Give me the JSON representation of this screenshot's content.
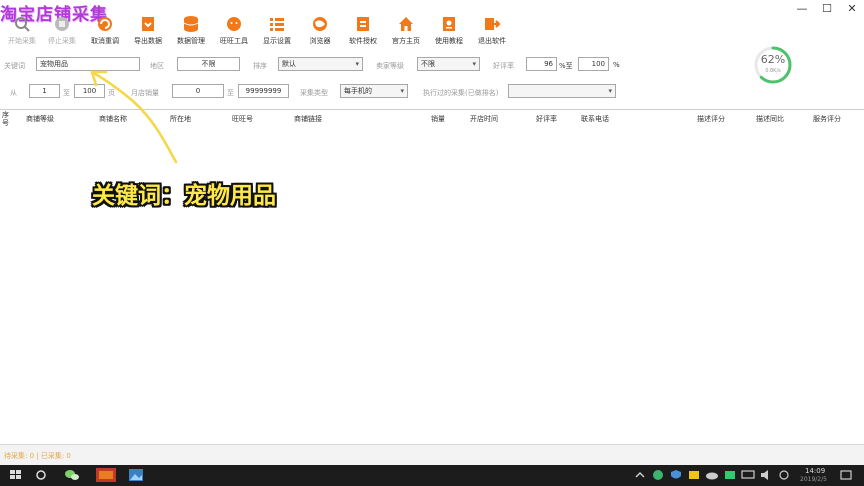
{
  "app": {
    "title": "淘宝店铺采集",
    "window_controls": {
      "minimize": "—",
      "restore": "☐",
      "close": "✕"
    }
  },
  "toolbar": {
    "buttons": [
      {
        "label": "开始采集",
        "icon": "search-icon",
        "color": "#888888",
        "enabled": false
      },
      {
        "label": "停止采集",
        "icon": "stop-icon",
        "color": "#999999",
        "enabled": false
      },
      {
        "label": "取消重调",
        "icon": "reload-icon",
        "color": "#f07a1a",
        "enabled": true
      },
      {
        "label": "导出数据",
        "icon": "export-icon",
        "color": "#f07a1a",
        "enabled": true
      },
      {
        "label": "数据管理",
        "icon": "database-icon",
        "color": "#f07a1a",
        "enabled": true
      },
      {
        "label": "旺旺工具",
        "icon": "chat-icon",
        "color": "#f07a1a",
        "enabled": true
      },
      {
        "label": "显示设置",
        "icon": "list-icon",
        "color": "#f07a1a",
        "enabled": true
      },
      {
        "label": "浏览器",
        "icon": "browser-icon",
        "color": "#f07a1a",
        "enabled": true
      },
      {
        "label": "软件授权",
        "icon": "license-icon",
        "color": "#f07a1a",
        "enabled": true
      },
      {
        "label": "官方主页",
        "icon": "home-icon",
        "color": "#f07a1a",
        "enabled": true
      },
      {
        "label": "使用教程",
        "icon": "tutorial-icon",
        "color": "#f07a1a",
        "enabled": true
      },
      {
        "label": "退出软件",
        "icon": "exit-icon",
        "color": "#f07a1a",
        "enabled": true
      }
    ]
  },
  "progress": {
    "percent_text": "62%",
    "value": 0.62,
    "speed": "0.8K/s"
  },
  "filters": {
    "keyword_label": "关键词",
    "keyword_value": "宠物用品",
    "region_label": "地区",
    "region_value": "不限",
    "sort_label": "排序",
    "sort_value": "默认",
    "seller_level_label": "卖家等级",
    "seller_level_value": "不限",
    "rating_label": "好评率",
    "rating_min": "96",
    "rating_sep": "%至",
    "rating_max": "100",
    "rating_unit": "%",
    "page_label": "从",
    "page_from": "1",
    "page_sep": "至",
    "page_to": "100",
    "page_unit": "页",
    "sales_label": "月店销量",
    "sales_min": "0",
    "sales_sep": "至",
    "sales_max": "99999999",
    "collect_label": "采集类型",
    "collect_value": "每手机的",
    "history_label": "执行过的采集(已做排名)",
    "history_value": ""
  },
  "table": {
    "headers": [
      "序号",
      "商铺等级",
      "商铺名称",
      "所在地",
      "旺旺号",
      "商铺链接",
      "销量",
      "开店时间",
      "好评率",
      "联系电话",
      "描述评分",
      "描述同比",
      "服务评分"
    ]
  },
  "annotation": {
    "text": "关键词：宠物用品",
    "color": "#ffe94a"
  },
  "statusbar": {
    "left_text": "待采集: 0 | 已采集: 0"
  },
  "taskbar": {
    "time": "14:09",
    "date": "2019/2/5"
  }
}
